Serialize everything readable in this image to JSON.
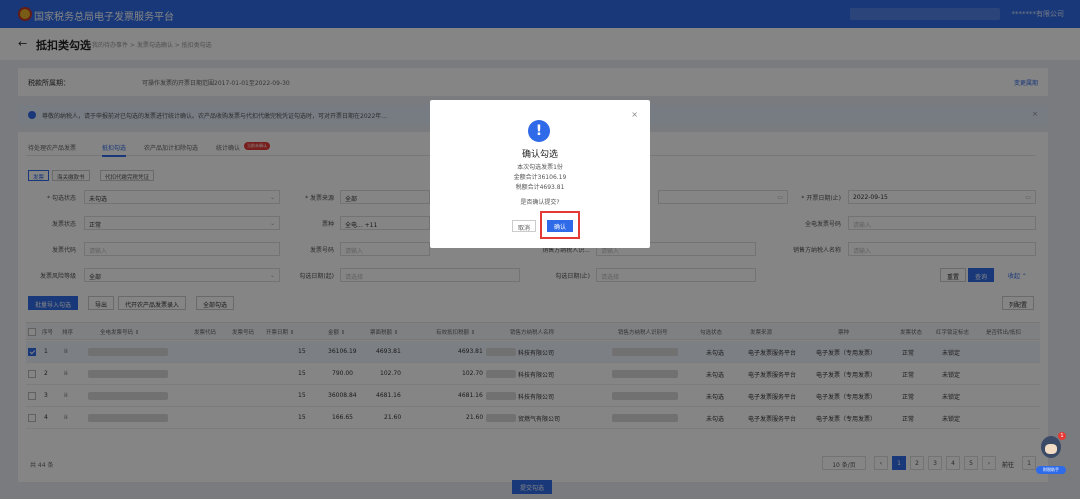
{
  "topbar": {
    "title": "国家税务总局电子发票服务平台",
    "company": "*******有限公司"
  },
  "header": {
    "back": "←",
    "title": "抵扣类勾选",
    "breadcrumb": "我的待办事件  >  发票勾选确认  >  抵扣类勾选"
  },
  "period": {
    "label": "税款所属期：",
    "scope": "可操作发票的开票日期范围2017-01-01至2022-09-30",
    "change": "变更属期"
  },
  "notice": {
    "text": "尊敬的纳税人，请于申报前对已勾选的发票进行统计确认。农产品收购发票与代扣代缴完税凭证勾选时，可对开票日期在2022年..."
  },
  "tabs": [
    {
      "label": "待处理农产品发票"
    },
    {
      "label": "抵扣勾选"
    },
    {
      "label": "农产品加计扣除勾选"
    },
    {
      "label": "统计确认"
    }
  ],
  "tab_badge": "当前未确认",
  "subtabs": [
    {
      "label": "发票"
    },
    {
      "label": "海关缴款书"
    },
    {
      "label": "代扣代缴完税凭证"
    }
  ],
  "filters": {
    "check_status_label": "* 勾选状态",
    "check_status_value": "未勾选",
    "invoice_status_label": "发票状态",
    "invoice_status_value": "正常",
    "invoice_code_label": "发票代码",
    "invoice_code_ph": "请输入",
    "risk_label": "发票风险等级",
    "risk_value": "全部",
    "source_label": "* 发票来源",
    "source_value": "全部",
    "type_label": "票种",
    "type_value": "全电...",
    "type_more": "+11",
    "number_label": "发票号码",
    "number_ph": "请输入",
    "check_date_label": "勾选日期(起)",
    "check_date_ph": "请选择",
    "seller_id_label": "销售方纳税人识...",
    "seller_id_ph": "请输入",
    "check_date_to_label": "勾选日期(止)",
    "check_date_to_ph": "请选择",
    "date_to_label": "* 开票日期(止)",
    "date_to_value": "2022-09-15",
    "full_number_label": "全电发票号码",
    "full_number_ph": "请输入",
    "seller_name_label": "销售方纳税人名称",
    "seller_name_ph": "请输入",
    "reset": "重置",
    "query": "查询",
    "collapse": "收起 ⌃"
  },
  "actions": {
    "batch_import": "批量导入勾选",
    "export": "导出",
    "agri_import": "代开农产品发票录入",
    "check_all": "全部勾选",
    "columns": "列配置"
  },
  "table": {
    "headers": [
      "序号",
      "排序",
      "全电发票号码 ⇕",
      "发票代码",
      "发票号码",
      "开票日期 ⇕",
      "金额 ⇕",
      "票面税额 ⇕",
      "有效抵扣税额 ⇕",
      "销售方纳税人名称",
      "销售方纳税人识别号",
      "勾选状态",
      "发票来源",
      "票种",
      "发票状态",
      "红字锁定标志",
      "是否转出/抵扣"
    ],
    "rows": [
      {
        "no": "1",
        "date": "15",
        "amount": "36106.19",
        "tax": "4693.81",
        "valid_tax": "4693.81",
        "seller": "科技有限公司",
        "status": "未勾选",
        "source": "电子发票服务平台",
        "type": "电子发票（专用发票）",
        "inv_status": "正常",
        "lock": "未锁定",
        "checked": true
      },
      {
        "no": "2",
        "date": "15",
        "amount": "790.00",
        "tax": "102.70",
        "valid_tax": "102.70",
        "seller": "科技有限公司",
        "status": "未勾选",
        "source": "电子发票服务平台",
        "type": "电子发票（专用发票）",
        "inv_status": "正常",
        "lock": "未锁定",
        "checked": false
      },
      {
        "no": "3",
        "date": "15",
        "amount": "36008.84",
        "tax": "4681.16",
        "valid_tax": "4681.16",
        "seller": "科技有限公司",
        "status": "未勾选",
        "source": "电子发票服务平台",
        "type": "电子发票（专用发票）",
        "inv_status": "正常",
        "lock": "未锁定",
        "checked": false
      },
      {
        "no": "4",
        "date": "15",
        "amount": "166.65",
        "tax": "21.60",
        "valid_tax": "21.60",
        "seller": "贸燃气有限公司",
        "status": "未勾选",
        "source": "电子发票服务平台",
        "type": "电子发票（专用发票）",
        "inv_status": "正常",
        "lock": "未锁定",
        "checked": false
      }
    ]
  },
  "pagination": {
    "total": "共 44 条",
    "per_page": "10 条/页",
    "pages": [
      "1",
      "2",
      "3",
      "4",
      "5"
    ],
    "goto": "前往",
    "goto_value": "1"
  },
  "submit": "提交勾选",
  "modal": {
    "title": "确认勾选",
    "line1": "本次勾选发票1份",
    "line2": "金额合计36106.19",
    "line3": "税额合计4693.81",
    "question": "是否确认提交?",
    "cancel": "取消",
    "ok": "确认",
    "close": "×",
    "icon": "!"
  },
  "assistant": {
    "label": "财税助手",
    "count": "1"
  },
  "colors": {
    "primary": "#2f6be8",
    "highlight": "#e53935"
  }
}
